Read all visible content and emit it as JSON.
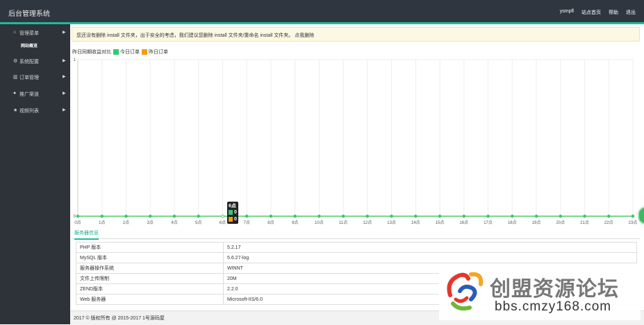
{
  "header": {
    "brand": "后台管理系统",
    "nav": [
      "ysmpfl",
      "站点首页",
      "帮助",
      "退出"
    ]
  },
  "sidebar": {
    "items": [
      {
        "icon": "home-icon",
        "label": "管理菜单"
      },
      {
        "icon": "gears-icon",
        "label": "系统配置"
      },
      {
        "icon": "bar-chart-icon",
        "label": "订单管理"
      },
      {
        "icon": "user-icon",
        "label": "推广渠道"
      },
      {
        "icon": "star-icon",
        "label": "视频列表"
      }
    ],
    "sub_item": "网站概览"
  },
  "notice": {
    "text": "您还没有删除 install 文件夹，出于安全的考虑，我们建议您删除 install 文件夹/重命名 install 文件夹。",
    "link": "点我删除"
  },
  "legend": {
    "prefix": "昨日同期收益对比",
    "today": "今日订单",
    "yesterday": "昨日订单",
    "today_color": "#2ecc71",
    "yesterday_color": "#f39c12"
  },
  "chart_data": {
    "type": "line",
    "categories": [
      "0点",
      "1点",
      "2点",
      "3点",
      "4点",
      "5点",
      "6点",
      "7点",
      "8点",
      "9点",
      "10点",
      "11点",
      "12点",
      "13点",
      "14点",
      "15点",
      "16点",
      "17点",
      "18点",
      "19点",
      "20点",
      "21点",
      "22点",
      "23点"
    ],
    "series": [
      {
        "name": "今日订单",
        "values": [
          0,
          0,
          0,
          0,
          0,
          0,
          0,
          0,
          0,
          0,
          0,
          0,
          0,
          0,
          0,
          0,
          0,
          0,
          0,
          0,
          0,
          0,
          0,
          0
        ],
        "color": "#2ecc71"
      },
      {
        "name": "昨日订单",
        "values": [
          0,
          0,
          0,
          0,
          0,
          0,
          0,
          0,
          0,
          0,
          0,
          0,
          0,
          0,
          0,
          0,
          0,
          0,
          0,
          0,
          0,
          0,
          0,
          0
        ],
        "color": "#f39c12"
      }
    ],
    "ylim": [
      0,
      1
    ],
    "yticks": [
      "0",
      "1"
    ],
    "grid": true,
    "tooltip": {
      "title": "6点",
      "values": [
        "0",
        "0"
      ]
    }
  },
  "tabs": {
    "active": "服务器信息"
  },
  "server_info": [
    [
      "PHP 版本",
      "5.2.17"
    ],
    [
      "MySQL 版本",
      "5.6.27-log"
    ],
    [
      "服务器操作系统",
      "WINNT"
    ],
    [
      "文件上传限制",
      "20M"
    ],
    [
      "ZEND版本",
      "2.2.0"
    ],
    [
      "Web 服务器",
      "Microsoft-IIS/6.0"
    ]
  ],
  "footer": {
    "text": "2017 © 版权所有 @ 2015-2017 1号源码屋"
  },
  "watermark": {
    "title": "创盟资源论坛",
    "url": "bbs.cmzy168.com"
  }
}
